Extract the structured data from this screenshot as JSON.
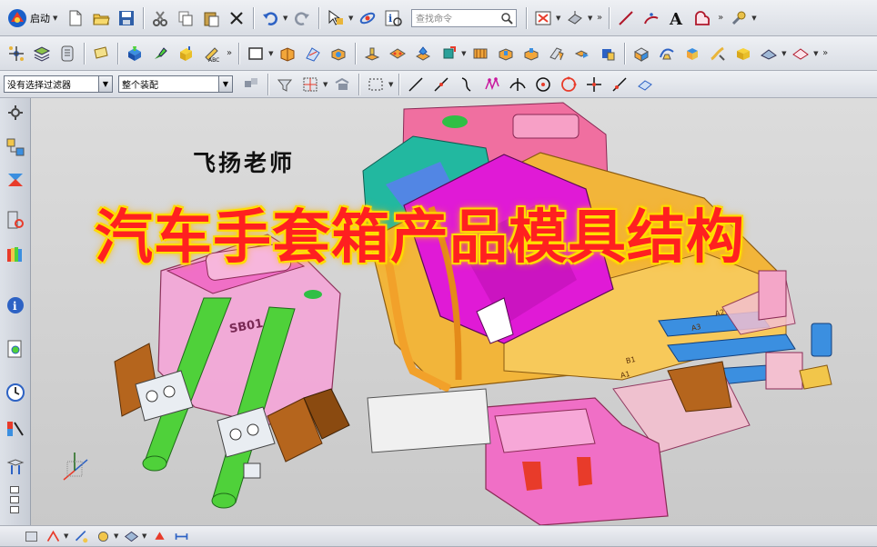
{
  "toolbar_main": {
    "start_label": "启动",
    "command_search_placeholder": "查找命令"
  },
  "toolbar_selection": {
    "type_filter": "没有选择过滤器",
    "scope": "整个装配"
  },
  "overlay": {
    "author": "飞扬老师",
    "title": "汽车手套箱产品模具结构"
  },
  "model_labels": {
    "slider_tag": "SB01",
    "a_labels": [
      "A1",
      "A2",
      "A3",
      "B1"
    ]
  },
  "colors": {
    "toolbar_bg": "#dfe3e9",
    "viewport_bg": "#d2d2d2",
    "title_red": "#ff2020",
    "title_glow": "#ffe600",
    "mold_yellow": "#f2b53a",
    "mold_pink": "#f06fc6",
    "mold_magenta": "#e01ad6",
    "mold_blue": "#3b8fe0",
    "mold_brown": "#b5651d",
    "mold_green": "#4fd13a",
    "mold_teal": "#22b8a0"
  },
  "icons": {
    "toolbar_main": [
      "nx-logo-icon",
      "new-file-icon",
      "open-folder-icon",
      "save-icon",
      "cut-icon",
      "copy-icon",
      "paste-icon",
      "delete-icon",
      "undo-icon",
      "redo-icon",
      "select-object-icon",
      "connect-icon",
      "info-icon",
      "search-icon",
      "hide-show-icon",
      "view-orient-icon",
      "line-icon",
      "arc-icon",
      "text-icon",
      "shape-icon",
      "wrench-icon"
    ],
    "toolbar_second": [
      "assembly-icon",
      "layer-icon",
      "list-icon",
      "note-icon",
      "mold-wizard-icon",
      "green-tool-icon",
      "yellow-box-icon",
      "abc-icon",
      "rectangle-icon",
      "orange-block-icon",
      "sketch-icon",
      "blue-part-icon",
      "pad-icon",
      "feature-icon",
      "hole-icon",
      "mold-base-icon",
      "cavity-icon",
      "core-icon",
      "ejector-icon",
      "slider-icon",
      "lifter-icon",
      "cooling-icon",
      "sub-insert-icon",
      "electrode-icon",
      "cube-icon",
      "trim-icon",
      "box-icon",
      "surface-icon",
      "shaded-icon",
      "cursor-icon"
    ],
    "toolbar_snap": [
      "snap-filter-icon",
      "measure-icon",
      "scroll-icon",
      "rect-select-icon",
      "line-snap-icon",
      "end-point-icon",
      "mid-point-icon",
      "control-point-icon",
      "intersection-icon",
      "arc-center-icon",
      "quadrant-icon",
      "cross-icon",
      "tangent-icon",
      "view-icon"
    ],
    "resource_bar": [
      "settings-icon",
      "assembly-navigator-icon",
      "constraint-navigator-icon",
      "part-navigator-icon",
      "reuse-library-icon",
      "internet-icon",
      "history-icon",
      "clock-icon",
      "roles-icon",
      "system-material-icon"
    ],
    "toolbar_bottom": [
      "tool-a-icon",
      "tool-b-icon",
      "tool-c-icon",
      "tool-d-icon",
      "tool-e-icon",
      "tool-f-icon",
      "tool-g-icon"
    ]
  }
}
